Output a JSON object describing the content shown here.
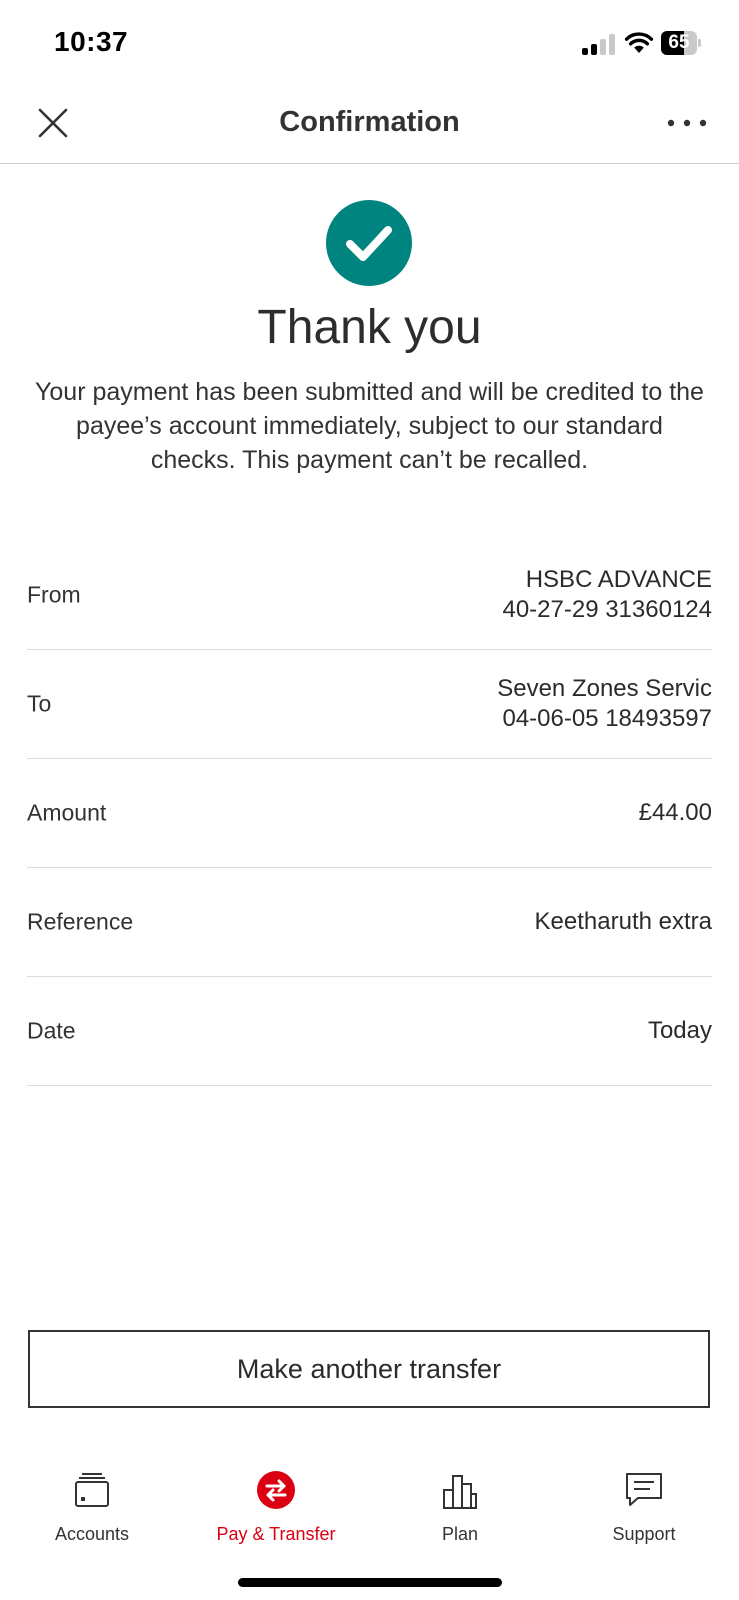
{
  "status_bar": {
    "time": "10:37",
    "battery_percent": "65",
    "battery_level": 0.65
  },
  "header": {
    "title": "Confirmation",
    "close_icon": "close-icon",
    "more_icon": "more-horizontal-icon"
  },
  "success": {
    "icon": "checkmark-circle-icon",
    "icon_color": "#00847f",
    "heading": "Thank you",
    "message": "Your payment has been submitted and will be credited to the payee’s account immediately, subject to our standard checks. This payment can’t be recalled."
  },
  "details": [
    {
      "label": "From",
      "lines": [
        "HSBC ADVANCE",
        "40-27-29 31360124"
      ]
    },
    {
      "label": "To",
      "lines": [
        "Seven Zones Servic",
        "04-06-05 18493597"
      ]
    },
    {
      "label": "Amount",
      "lines": [
        "£44.00"
      ]
    },
    {
      "label": "Reference",
      "lines": [
        "Keetharuth extra"
      ]
    },
    {
      "label": "Date",
      "lines": [
        "Today"
      ]
    }
  ],
  "actions": {
    "transfer_label": "Make another transfer"
  },
  "tabs": [
    {
      "label": "Accounts",
      "icon": "wallet-icon",
      "active": false
    },
    {
      "label": "Pay & Transfer",
      "icon": "transfer-arrows-icon",
      "active": true
    },
    {
      "label": "Plan",
      "icon": "bar-chart-icon",
      "active": false
    },
    {
      "label": "Support",
      "icon": "chat-bubble-icon",
      "active": false
    }
  ],
  "colors": {
    "accent_red": "#db0011",
    "success_green": "#00847f"
  }
}
